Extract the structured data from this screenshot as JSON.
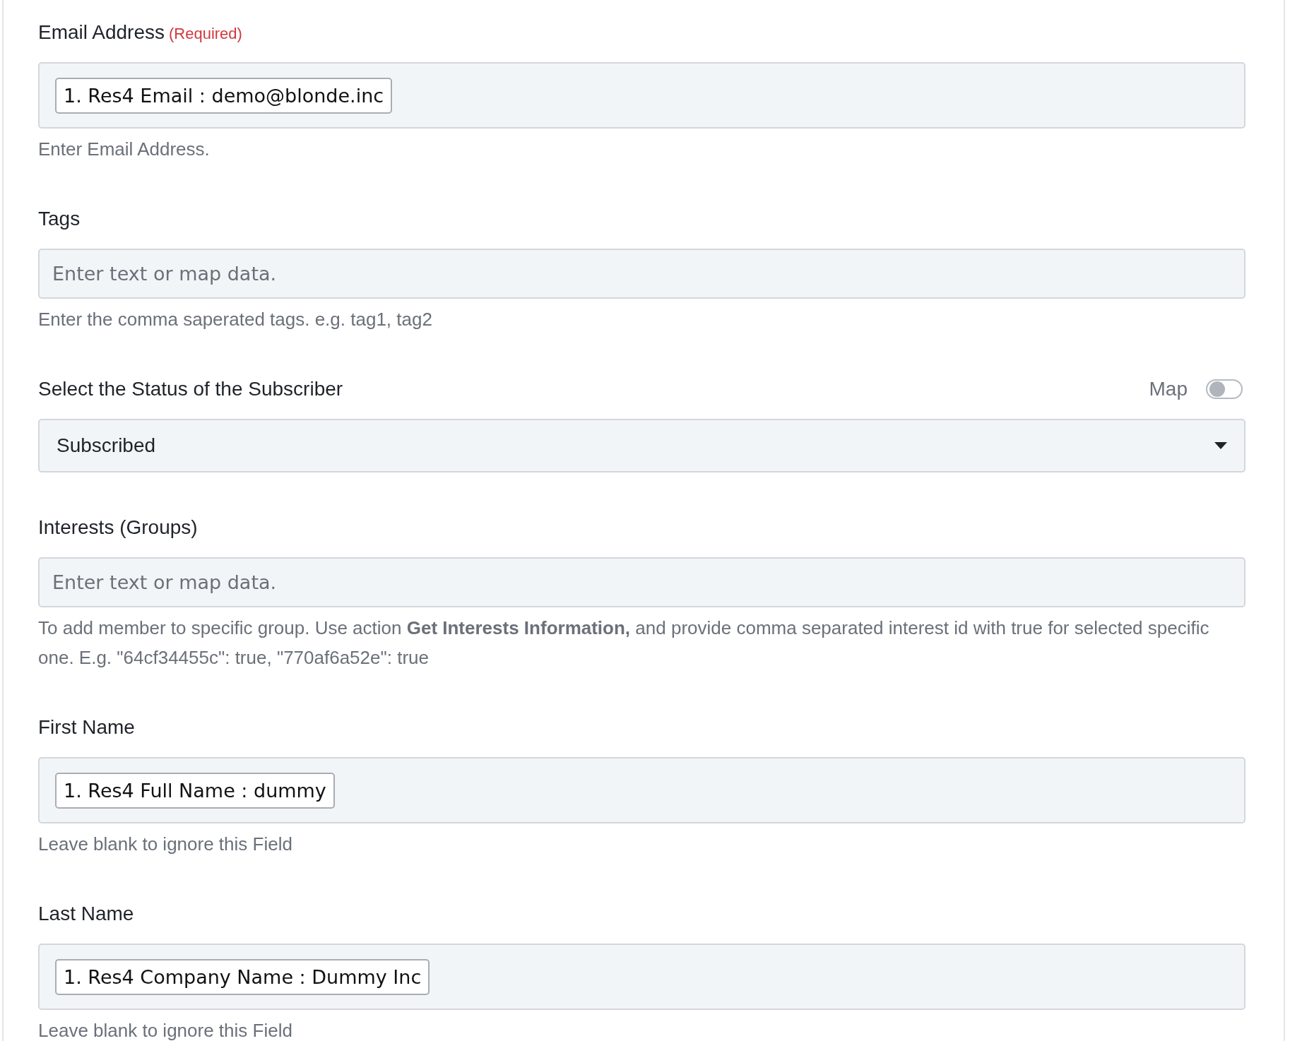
{
  "fields": [
    {
      "label": "Email Address",
      "required": "(Required)",
      "kind": "chips",
      "chips": [
        "1. Res4 Email : demo@blonde.inc"
      ],
      "help": "Enter Email Address."
    },
    {
      "label": "Tags",
      "kind": "text",
      "placeholder": "Enter text or map data.",
      "help": "Enter the comma saperated tags. e.g. tag1, tag2"
    },
    {
      "label": "Select the Status of the Subscriber",
      "kind": "select",
      "value": "Subscribed",
      "map_toggle": {
        "label": "Map",
        "on": false
      }
    },
    {
      "label": "Interests (Groups)",
      "kind": "text",
      "placeholder": "Enter text or map data.",
      "help": "To add member to specific group. Use action **Get Interests Information,** and provide comma separated interest id with true for selected specific one. E.g. \"64cf34455c\": true, \"770af6a52e\": true"
    },
    {
      "label": "First Name",
      "kind": "chips",
      "chips": [
        "1. Res4 Full Name : dummy"
      ],
      "help": "Leave blank to ignore this Field"
    },
    {
      "label": "Last Name",
      "kind": "chips",
      "chips": [
        "1. Res4 Company Name : Dummy Inc"
      ],
      "help": "Leave blank to ignore this Field"
    }
  ]
}
